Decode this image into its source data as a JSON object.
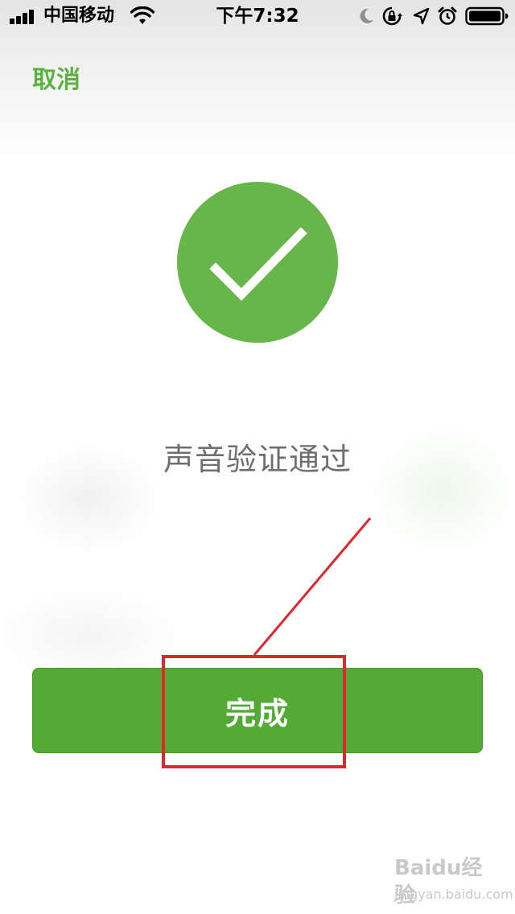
{
  "status_bar": {
    "carrier": "中国移动",
    "time": "下午7:32"
  },
  "nav": {
    "cancel_label": "取消"
  },
  "result": {
    "message": "声音验证通过"
  },
  "actions": {
    "done_label": "完成"
  },
  "watermark": {
    "brand": "Baidu经验",
    "url": "jingyan.baidu.com"
  },
  "colors": {
    "accent": "#5cb23f",
    "button": "#53aa37",
    "circle": "#66b64a",
    "annotation": "#e0262e"
  },
  "icons": [
    "signal-icon",
    "wifi-icon",
    "moon-icon",
    "rotation-lock-icon",
    "location-icon",
    "alarm-icon",
    "battery-icon",
    "checkmark-icon"
  ]
}
